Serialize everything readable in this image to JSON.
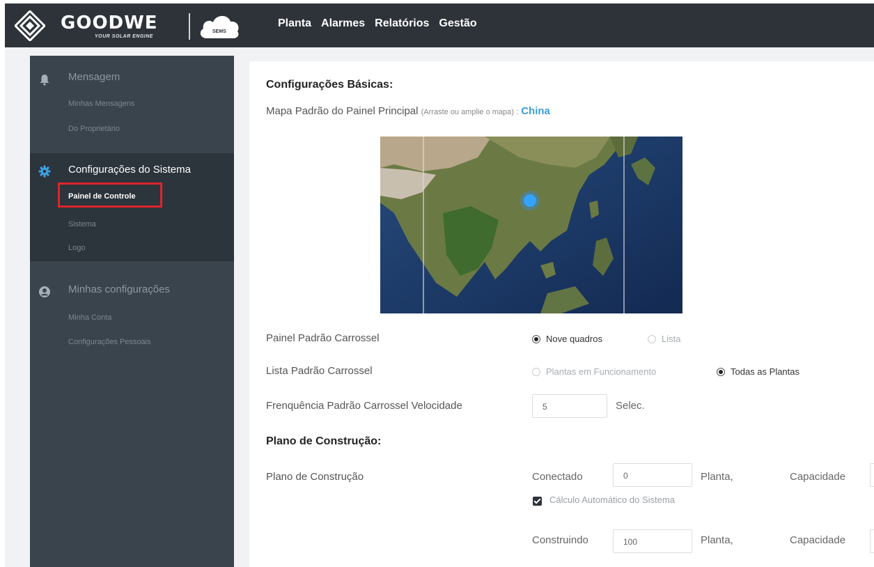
{
  "brand": {
    "name": "GOODWE",
    "tagline": "YOUR SOLAR ENGINE",
    "cloud_label": "SEMS"
  },
  "topnav": [
    "Planta",
    "Alarmes",
    "Relatórios",
    "Gestão"
  ],
  "sidebar": {
    "groups": [
      {
        "title": "Mensagem",
        "icon": "bell-icon",
        "items": [
          "Minhas Mensagens",
          "Do Proprietário"
        ]
      },
      {
        "title": "Configurações do Sistema",
        "icon": "gear-icon",
        "items": [
          "Painel de Controle",
          "Sistema",
          "Logo"
        ],
        "selected": "Painel de Controle"
      },
      {
        "title": "Minhas configurações",
        "icon": "user-icon",
        "items": [
          "Minha Conta",
          "Configurações Pessoais"
        ]
      }
    ]
  },
  "main": {
    "basic_title": "Configurações Básicas:",
    "map_label": "Mapa Padrão do Painel Principal",
    "map_hint": "(Arraste ou amplie o mapa) :",
    "map_country": "China",
    "carousel_panel": {
      "label": "Painel Padrão Carrossel",
      "options": [
        "Nove quadros",
        "Lista"
      ],
      "selected": "Nove quadros"
    },
    "carousel_list": {
      "label": "Lista Padrão Carrossel",
      "options": [
        "Plantas em Funcionamento",
        "Todas as Plantas"
      ],
      "selected": "Todas as Plantas"
    },
    "carousel_speed": {
      "label": "Frenquência Padrão Carrossel Velocidade",
      "value": "5",
      "unit": "Selec."
    },
    "build_title": "Plano de Construção:",
    "build_label": "Plano de Construção",
    "connected": {
      "label": "Conectado",
      "value": "0",
      "unit": "Planta,",
      "capacity_label": "Capacidade"
    },
    "auto_calc": {
      "label": "Cálculo Automático do Sistema",
      "checked": true
    },
    "building": {
      "label": "Construindo",
      "value": "100",
      "unit": "Planta,",
      "capacity_label": "Capacidade"
    }
  },
  "colors": {
    "topbar": "#2d3339",
    "sidebar": "#3a444d",
    "highlight": "#e0242c",
    "accent": "#3a9fd6"
  }
}
